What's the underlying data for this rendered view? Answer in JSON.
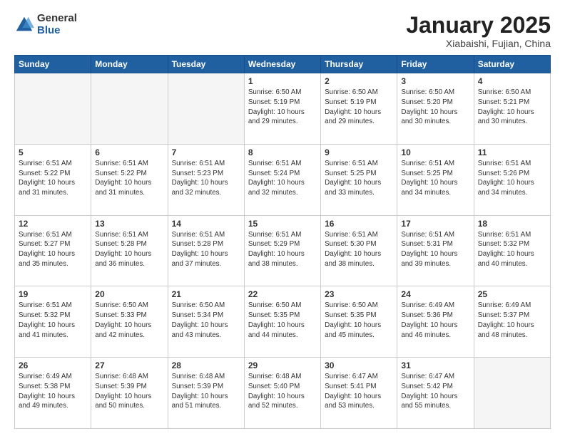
{
  "logo": {
    "general": "General",
    "blue": "Blue"
  },
  "header": {
    "title": "January 2025",
    "subtitle": "Xiabaishi, Fujian, China"
  },
  "weekdays": [
    "Sunday",
    "Monday",
    "Tuesday",
    "Wednesday",
    "Thursday",
    "Friday",
    "Saturday"
  ],
  "weeks": [
    [
      {
        "day": "",
        "info": ""
      },
      {
        "day": "",
        "info": ""
      },
      {
        "day": "",
        "info": ""
      },
      {
        "day": "1",
        "info": "Sunrise: 6:50 AM\nSunset: 5:19 PM\nDaylight: 10 hours\nand 29 minutes."
      },
      {
        "day": "2",
        "info": "Sunrise: 6:50 AM\nSunset: 5:19 PM\nDaylight: 10 hours\nand 29 minutes."
      },
      {
        "day": "3",
        "info": "Sunrise: 6:50 AM\nSunset: 5:20 PM\nDaylight: 10 hours\nand 30 minutes."
      },
      {
        "day": "4",
        "info": "Sunrise: 6:50 AM\nSunset: 5:21 PM\nDaylight: 10 hours\nand 30 minutes."
      }
    ],
    [
      {
        "day": "5",
        "info": "Sunrise: 6:51 AM\nSunset: 5:22 PM\nDaylight: 10 hours\nand 31 minutes."
      },
      {
        "day": "6",
        "info": "Sunrise: 6:51 AM\nSunset: 5:22 PM\nDaylight: 10 hours\nand 31 minutes."
      },
      {
        "day": "7",
        "info": "Sunrise: 6:51 AM\nSunset: 5:23 PM\nDaylight: 10 hours\nand 32 minutes."
      },
      {
        "day": "8",
        "info": "Sunrise: 6:51 AM\nSunset: 5:24 PM\nDaylight: 10 hours\nand 32 minutes."
      },
      {
        "day": "9",
        "info": "Sunrise: 6:51 AM\nSunset: 5:25 PM\nDaylight: 10 hours\nand 33 minutes."
      },
      {
        "day": "10",
        "info": "Sunrise: 6:51 AM\nSunset: 5:25 PM\nDaylight: 10 hours\nand 34 minutes."
      },
      {
        "day": "11",
        "info": "Sunrise: 6:51 AM\nSunset: 5:26 PM\nDaylight: 10 hours\nand 34 minutes."
      }
    ],
    [
      {
        "day": "12",
        "info": "Sunrise: 6:51 AM\nSunset: 5:27 PM\nDaylight: 10 hours\nand 35 minutes."
      },
      {
        "day": "13",
        "info": "Sunrise: 6:51 AM\nSunset: 5:28 PM\nDaylight: 10 hours\nand 36 minutes."
      },
      {
        "day": "14",
        "info": "Sunrise: 6:51 AM\nSunset: 5:28 PM\nDaylight: 10 hours\nand 37 minutes."
      },
      {
        "day": "15",
        "info": "Sunrise: 6:51 AM\nSunset: 5:29 PM\nDaylight: 10 hours\nand 38 minutes."
      },
      {
        "day": "16",
        "info": "Sunrise: 6:51 AM\nSunset: 5:30 PM\nDaylight: 10 hours\nand 38 minutes."
      },
      {
        "day": "17",
        "info": "Sunrise: 6:51 AM\nSunset: 5:31 PM\nDaylight: 10 hours\nand 39 minutes."
      },
      {
        "day": "18",
        "info": "Sunrise: 6:51 AM\nSunset: 5:32 PM\nDaylight: 10 hours\nand 40 minutes."
      }
    ],
    [
      {
        "day": "19",
        "info": "Sunrise: 6:51 AM\nSunset: 5:32 PM\nDaylight: 10 hours\nand 41 minutes."
      },
      {
        "day": "20",
        "info": "Sunrise: 6:50 AM\nSunset: 5:33 PM\nDaylight: 10 hours\nand 42 minutes."
      },
      {
        "day": "21",
        "info": "Sunrise: 6:50 AM\nSunset: 5:34 PM\nDaylight: 10 hours\nand 43 minutes."
      },
      {
        "day": "22",
        "info": "Sunrise: 6:50 AM\nSunset: 5:35 PM\nDaylight: 10 hours\nand 44 minutes."
      },
      {
        "day": "23",
        "info": "Sunrise: 6:50 AM\nSunset: 5:35 PM\nDaylight: 10 hours\nand 45 minutes."
      },
      {
        "day": "24",
        "info": "Sunrise: 6:49 AM\nSunset: 5:36 PM\nDaylight: 10 hours\nand 46 minutes."
      },
      {
        "day": "25",
        "info": "Sunrise: 6:49 AM\nSunset: 5:37 PM\nDaylight: 10 hours\nand 48 minutes."
      }
    ],
    [
      {
        "day": "26",
        "info": "Sunrise: 6:49 AM\nSunset: 5:38 PM\nDaylight: 10 hours\nand 49 minutes."
      },
      {
        "day": "27",
        "info": "Sunrise: 6:48 AM\nSunset: 5:39 PM\nDaylight: 10 hours\nand 50 minutes."
      },
      {
        "day": "28",
        "info": "Sunrise: 6:48 AM\nSunset: 5:39 PM\nDaylight: 10 hours\nand 51 minutes."
      },
      {
        "day": "29",
        "info": "Sunrise: 6:48 AM\nSunset: 5:40 PM\nDaylight: 10 hours\nand 52 minutes."
      },
      {
        "day": "30",
        "info": "Sunrise: 6:47 AM\nSunset: 5:41 PM\nDaylight: 10 hours\nand 53 minutes."
      },
      {
        "day": "31",
        "info": "Sunrise: 6:47 AM\nSunset: 5:42 PM\nDaylight: 10 hours\nand 55 minutes."
      },
      {
        "day": "",
        "info": ""
      }
    ]
  ]
}
